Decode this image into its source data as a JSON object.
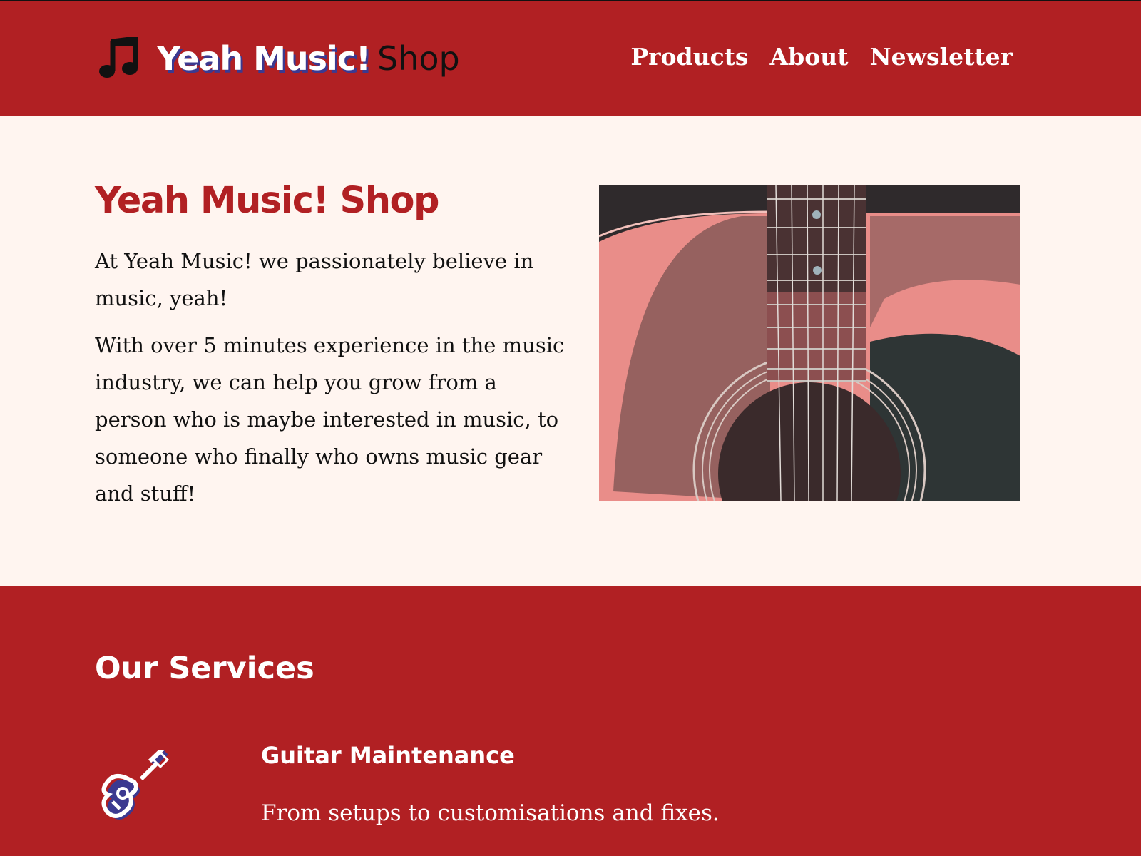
{
  "header": {
    "logo_strong": "Yeah Music!",
    "logo_light": "Shop",
    "logo_icon": "music-note-icon",
    "nav": [
      {
        "label": "Products"
      },
      {
        "label": "About"
      },
      {
        "label": "Newsletter"
      }
    ]
  },
  "hero": {
    "title": "Yeah Music! Shop",
    "paragraphs": [
      "At Yeah Music! we passionately believe in music, yeah!",
      "With over 5 minutes experience in the music industry, we can help you grow from a person who is maybe interested in music, to someone who finally who owns music gear and stuff!"
    ],
    "image": "acoustic-guitar-photo"
  },
  "services": {
    "title": "Our Services",
    "items": [
      {
        "icon": "guitar-icon",
        "name": "Guitar Maintenance",
        "description": "From setups to customisations and fixes."
      }
    ]
  },
  "colors": {
    "brand_red": "#b12023",
    "cream": "#fff5f0",
    "accent_blue": "#3b3990",
    "text_dark": "#111111"
  }
}
